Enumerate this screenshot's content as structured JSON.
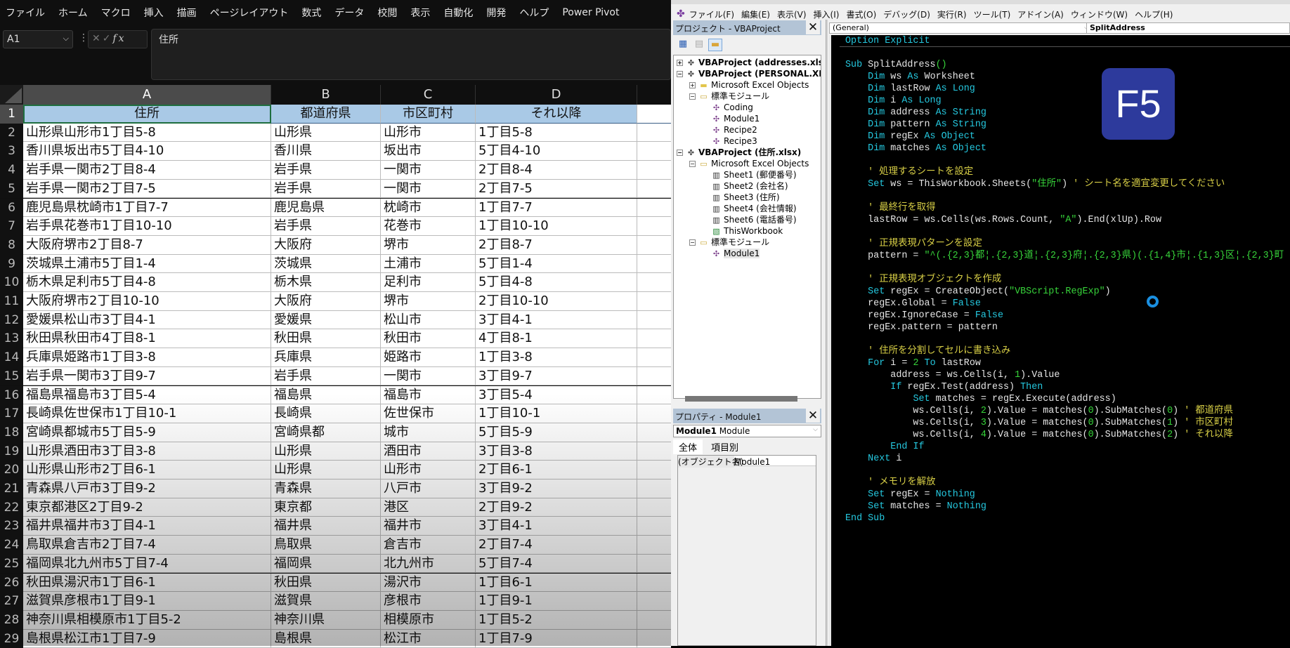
{
  "excel": {
    "menu": [
      "ファイル",
      "ホーム",
      "マクロ",
      "挿入",
      "描画",
      "ページレイアウト",
      "数式",
      "データ",
      "校閲",
      "表示",
      "自動化",
      "開発",
      "ヘルプ",
      "Power Pivot"
    ],
    "name_box": "A1",
    "fx_label": "fx",
    "formula": "住所",
    "columns": [
      "A",
      "B",
      "C",
      "D"
    ],
    "selected_cell": "A1",
    "header": [
      "住所",
      "都道府県",
      "市区町村",
      "それ以降"
    ],
    "rows": [
      [
        "山形県山形市1丁目5-8",
        "山形県",
        "山形市",
        "1丁目5-8"
      ],
      [
        "香川県坂出市5丁目4-10",
        "香川県",
        "坂出市",
        "5丁目4-10"
      ],
      [
        "岩手県一関市2丁目8-4",
        "岩手県",
        "一関市",
        "2丁目8-4"
      ],
      [
        "岩手県一関市2丁目7-5",
        "岩手県",
        "一関市",
        "2丁目7-5"
      ],
      [
        "鹿児島県枕崎市1丁目7-7",
        "鹿児島県",
        "枕崎市",
        "1丁目7-7"
      ],
      [
        "岩手県花巻市1丁目10-10",
        "岩手県",
        "花巻市",
        "1丁目10-10"
      ],
      [
        "大阪府堺市2丁目8-7",
        "大阪府",
        "堺市",
        "2丁目8-7"
      ],
      [
        "茨城県土浦市5丁目1-4",
        "茨城県",
        "土浦市",
        "5丁目1-4"
      ],
      [
        "栃木県足利市5丁目4-8",
        "栃木県",
        "足利市",
        "5丁目4-8"
      ],
      [
        "大阪府堺市2丁目10-10",
        "大阪府",
        "堺市",
        "2丁目10-10"
      ],
      [
        "愛媛県松山市3丁目4-1",
        "愛媛県",
        "松山市",
        "3丁目4-1"
      ],
      [
        "秋田県秋田市4丁目8-1",
        "秋田県",
        "秋田市",
        "4丁目8-1"
      ],
      [
        "兵庫県姫路市1丁目3-8",
        "兵庫県",
        "姫路市",
        "1丁目3-8"
      ],
      [
        "岩手県一関市3丁目9-7",
        "岩手県",
        "一関市",
        "3丁目9-7"
      ],
      [
        "福島県福島市3丁目5-4",
        "福島県",
        "福島市",
        "3丁目5-4"
      ],
      [
        "長崎県佐世保市1丁目10-1",
        "長崎県",
        "佐世保市",
        "1丁目10-1"
      ],
      [
        "宮崎県都城市5丁目5-9",
        "宮崎県都",
        "城市",
        "5丁目5-9"
      ],
      [
        "山形県酒田市3丁目3-8",
        "山形県",
        "酒田市",
        "3丁目3-8"
      ],
      [
        "山形県山形市2丁目6-1",
        "山形県",
        "山形市",
        "2丁目6-1"
      ],
      [
        "青森県八戸市3丁目9-2",
        "青森県",
        "八戸市",
        "3丁目9-2"
      ],
      [
        "東京都港区2丁目9-2",
        "東京都",
        "港区",
        "2丁目9-2"
      ],
      [
        "福井県福井市3丁目4-1",
        "福井県",
        "福井市",
        "3丁目4-1"
      ],
      [
        "鳥取県倉吉市2丁目7-4",
        "鳥取県",
        "倉吉市",
        "2丁目7-4"
      ],
      [
        "福岡県北九州市5丁目7-4",
        "福岡県",
        "北九州市",
        "5丁目7-4"
      ],
      [
        "秋田県湯沢市1丁目6-1",
        "秋田県",
        "湯沢市",
        "1丁目6-1"
      ],
      [
        "滋賀県彦根市1丁目9-1",
        "滋賀県",
        "彦根市",
        "1丁目9-1"
      ],
      [
        "神奈川県相模原市1丁目5-2",
        "神奈川県",
        "相模原市",
        "1丁目5-2"
      ],
      [
        "島根県松江市1丁目7-9",
        "島根県",
        "松江市",
        "1丁目7-9"
      ]
    ]
  },
  "vbe": {
    "menu": [
      "ファイル(F)",
      "編集(E)",
      "表示(V)",
      "挿入(I)",
      "書式(O)",
      "デバッグ(D)",
      "実行(R)",
      "ツール(T)",
      "アドイン(A)",
      "ウィンドウ(W)",
      "ヘルプ(H)"
    ],
    "project_title": "プロジェクト - VBAProject",
    "tree": [
      {
        "label": "VBAProject (addresses.xlsx)",
        "level": 0,
        "expander": "+",
        "icon": "project",
        "bold": true
      },
      {
        "label": "VBAProject (PERSONAL.XLSB)",
        "level": 0,
        "expander": "-",
        "icon": "project",
        "bold": true
      },
      {
        "label": "Microsoft Excel Objects",
        "level": 1,
        "expander": "+",
        "icon": "folder"
      },
      {
        "label": "標準モジュール",
        "level": 1,
        "expander": "-",
        "icon": "folder-open"
      },
      {
        "label": "Coding",
        "level": 2,
        "icon": "module"
      },
      {
        "label": "Module1",
        "level": 2,
        "icon": "module"
      },
      {
        "label": "Recipe2",
        "level": 2,
        "icon": "module"
      },
      {
        "label": "Recipe3",
        "level": 2,
        "icon": "module"
      },
      {
        "label": "VBAProject (住所.xlsx)",
        "level": 0,
        "expander": "-",
        "icon": "project",
        "bold": true
      },
      {
        "label": "Microsoft Excel Objects",
        "level": 1,
        "expander": "-",
        "icon": "folder-open"
      },
      {
        "label": "Sheet1 (郵便番号)",
        "level": 2,
        "icon": "sheet"
      },
      {
        "label": "Sheet2 (会社名)",
        "level": 2,
        "icon": "sheet"
      },
      {
        "label": "Sheet3 (住所)",
        "level": 2,
        "icon": "sheet"
      },
      {
        "label": "Sheet4 (会社情報)",
        "level": 2,
        "icon": "sheet"
      },
      {
        "label": "Sheet6 (電話番号)",
        "level": 2,
        "icon": "sheet"
      },
      {
        "label": "ThisWorkbook",
        "level": 2,
        "icon": "workbook"
      },
      {
        "label": "標準モジュール",
        "level": 1,
        "expander": "-",
        "icon": "folder-open"
      },
      {
        "label": "Module1",
        "level": 2,
        "icon": "module",
        "selected": true
      }
    ],
    "properties_title": "プロパティ - Module1",
    "properties_object_name": "Module1",
    "properties_object_type": "Module",
    "properties_tabs": [
      "全体",
      "項目別"
    ],
    "properties_key": "(オブジェクト名)",
    "properties_value": "Module1",
    "object_combo": "(General)",
    "procedure_combo": "SplitAddress",
    "code": [
      [
        [
          "kw",
          "Option Explicit"
        ]
      ],
      [],
      [
        [
          "kw",
          "Sub"
        ],
        [
          "p",
          " SplitAddress"
        ],
        [
          "str",
          "()"
        ]
      ],
      [
        [
          "p",
          "    "
        ],
        [
          "kw",
          "Dim"
        ],
        [
          "p",
          " ws "
        ],
        [
          "kw",
          "As"
        ],
        [
          "p",
          " Worksheet"
        ]
      ],
      [
        [
          "p",
          "    "
        ],
        [
          "kw",
          "Dim"
        ],
        [
          "p",
          " lastRow "
        ],
        [
          "kw",
          "As Long"
        ]
      ],
      [
        [
          "p",
          "    "
        ],
        [
          "kw",
          "Dim"
        ],
        [
          "p",
          " i "
        ],
        [
          "kw",
          "As Long"
        ]
      ],
      [
        [
          "p",
          "    "
        ],
        [
          "kw",
          "Dim"
        ],
        [
          "p",
          " address "
        ],
        [
          "kw",
          "As String"
        ]
      ],
      [
        [
          "p",
          "    "
        ],
        [
          "kw",
          "Dim"
        ],
        [
          "p",
          " pattern "
        ],
        [
          "kw",
          "As String"
        ]
      ],
      [
        [
          "p",
          "    "
        ],
        [
          "kw",
          "Dim"
        ],
        [
          "p",
          " regEx "
        ],
        [
          "kw",
          "As Object"
        ]
      ],
      [
        [
          "p",
          "    "
        ],
        [
          "kw",
          "Dim"
        ],
        [
          "p",
          " matches "
        ],
        [
          "kw",
          "As Object"
        ]
      ],
      [],
      [
        [
          "cmt",
          "    ' 処理するシートを設定"
        ]
      ],
      [
        [
          "p",
          "    "
        ],
        [
          "kw",
          "Set"
        ],
        [
          "p",
          " ws = ThisWorkbook.Sheets("
        ],
        [
          "str",
          "\"住所\""
        ],
        [
          "p",
          ") "
        ],
        [
          "cmt",
          "' シート名を適宜変更してください"
        ]
      ],
      [],
      [
        [
          "cmt",
          "    ' 最終行を取得"
        ]
      ],
      [
        [
          "p",
          "    lastRow = ws.Cells(ws.Rows.Count, "
        ],
        [
          "str",
          "\"A\""
        ],
        [
          "p",
          ").End(xlUp).Row"
        ]
      ],
      [],
      [
        [
          "cmt",
          "    ' 正規表現パターンを設定"
        ]
      ],
      [
        [
          "p",
          "    pattern = "
        ],
        [
          "str",
          "\"^(.{2,3}都¦.{2,3}道¦.{2,3}府¦.{2,3}県)(.{1,4}市¦.{1,3}区¦.{2,3}町"
        ]
      ],
      [],
      [
        [
          "cmt",
          "    ' 正規表現オブジェクトを作成"
        ]
      ],
      [
        [
          "p",
          "    "
        ],
        [
          "kw",
          "Set"
        ],
        [
          "p",
          " regEx = CreateObject("
        ],
        [
          "str",
          "\"VBScript.RegExp\""
        ],
        [
          "p",
          ")"
        ]
      ],
      [
        [
          "p",
          "    regEx.Global = "
        ],
        [
          "kw",
          "False"
        ]
      ],
      [
        [
          "p",
          "    regEx.IgnoreCase = "
        ],
        [
          "kw",
          "False"
        ]
      ],
      [
        [
          "p",
          "    regEx.pattern = pattern"
        ]
      ],
      [],
      [
        [
          "cmt",
          "    ' 住所を分割してセルに書き込み"
        ]
      ],
      [
        [
          "p",
          "    "
        ],
        [
          "kw",
          "For"
        ],
        [
          "p",
          " i = "
        ],
        [
          "num",
          "2"
        ],
        [
          "p",
          " "
        ],
        [
          "kw",
          "To"
        ],
        [
          "p",
          " lastRow"
        ]
      ],
      [
        [
          "p",
          "        address = ws.Cells(i, "
        ],
        [
          "num",
          "1"
        ],
        [
          "p",
          ").Value"
        ]
      ],
      [
        [
          "p",
          "        "
        ],
        [
          "kw",
          "If"
        ],
        [
          "p",
          " regEx.Test(address) "
        ],
        [
          "kw",
          "Then"
        ]
      ],
      [
        [
          "p",
          "            "
        ],
        [
          "kw",
          "Set"
        ],
        [
          "p",
          " matches = regEx.Execute(address)"
        ]
      ],
      [
        [
          "p",
          "            ws.Cells(i, "
        ],
        [
          "num",
          "2"
        ],
        [
          "p",
          ").Value = matches("
        ],
        [
          "num",
          "0"
        ],
        [
          "p",
          ").SubMatches("
        ],
        [
          "num",
          "0"
        ],
        [
          "p",
          ") "
        ],
        [
          "cmt",
          "' 都道府県"
        ]
      ],
      [
        [
          "p",
          "            ws.Cells(i, "
        ],
        [
          "num",
          "3"
        ],
        [
          "p",
          ").Value = matches("
        ],
        [
          "num",
          "0"
        ],
        [
          "p",
          ").SubMatches("
        ],
        [
          "num",
          "1"
        ],
        [
          "p",
          ") "
        ],
        [
          "cmt",
          "' 市区町村"
        ]
      ],
      [
        [
          "p",
          "            ws.Cells(i, "
        ],
        [
          "num",
          "4"
        ],
        [
          "p",
          ").Value = matches("
        ],
        [
          "num",
          "0"
        ],
        [
          "p",
          ").SubMatches("
        ],
        [
          "num",
          "2"
        ],
        [
          "p",
          ") "
        ],
        [
          "cmt",
          "' それ以降"
        ]
      ],
      [
        [
          "p",
          "        "
        ],
        [
          "kw",
          "End If"
        ]
      ],
      [
        [
          "p",
          "    "
        ],
        [
          "kw",
          "Next"
        ],
        [
          "p",
          " i"
        ]
      ],
      [],
      [
        [
          "cmt",
          "    ' メモリを解放"
        ]
      ],
      [
        [
          "p",
          "    "
        ],
        [
          "kw",
          "Set"
        ],
        [
          "p",
          " regEx = "
        ],
        [
          "kw",
          "Nothing"
        ]
      ],
      [
        [
          "p",
          "    "
        ],
        [
          "kw",
          "Set"
        ],
        [
          "p",
          " matches = "
        ],
        [
          "kw",
          "Nothing"
        ]
      ],
      [
        [
          "kw",
          "End Sub"
        ]
      ]
    ]
  },
  "overlay": {
    "key_badge": "F5"
  },
  "colors": {
    "keyword": "#25c9e0",
    "string": "#37d43a",
    "comment": "#d8cf46",
    "header_fill": "#a9c9e6",
    "badge": "#2d3a9c"
  }
}
